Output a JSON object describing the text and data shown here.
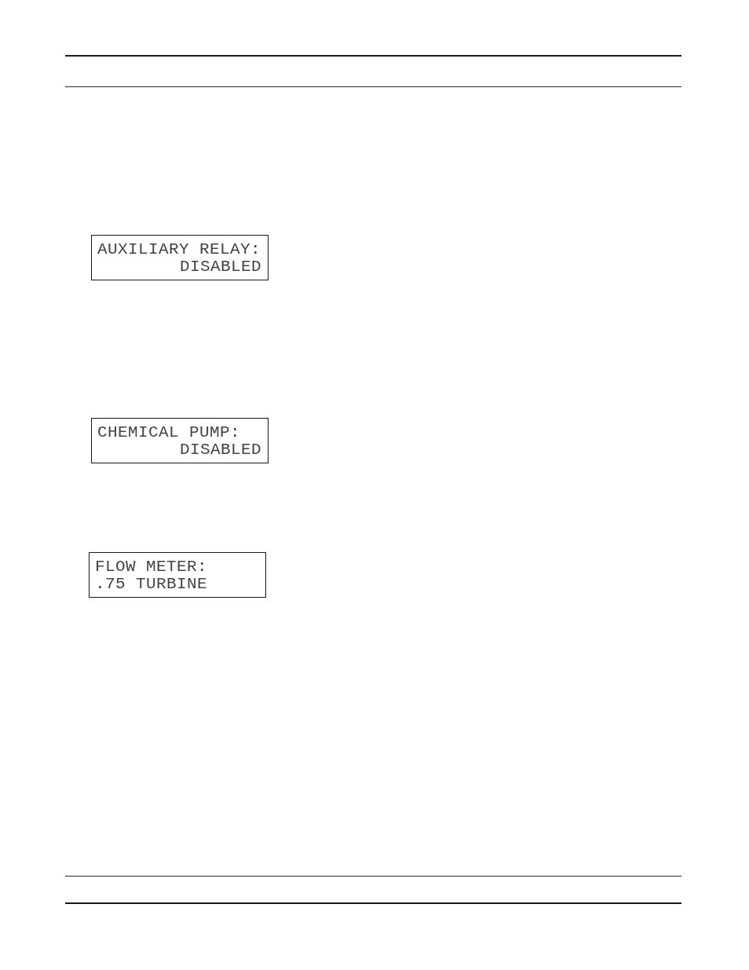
{
  "displays": [
    {
      "kind": "toggle",
      "lines": [
        "AUXILIARY RELAY:",
        "DISABLED"
      ]
    },
    {
      "kind": "toggle",
      "lines": [
        "CHEMICAL PUMP:",
        "DISABLED"
      ]
    },
    {
      "kind": "choice",
      "lines": [
        "FLOW METER:",
        ".75 TURBINE"
      ]
    }
  ]
}
